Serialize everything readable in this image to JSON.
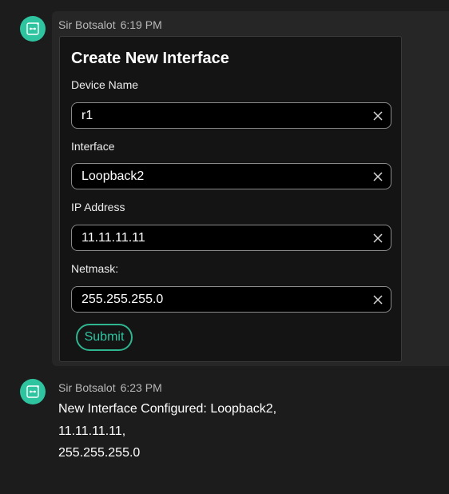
{
  "messages": [
    {
      "sender": "Sir Botsalot",
      "time": "6:19 PM",
      "form": {
        "title": "Create New Interface",
        "fields": [
          {
            "label": "Device Name",
            "value": "r1"
          },
          {
            "label": "Interface",
            "value": "Loopback2"
          },
          {
            "label": "IP Address",
            "value": "11.11.11.11"
          },
          {
            "label": "Netmask:",
            "value": "255.255.255.0"
          }
        ],
        "submit_label": "Submit"
      }
    },
    {
      "sender": "Sir Botsalot",
      "time": "6:23 PM",
      "lines": [
        "New Interface Configured: Loopback2,",
        "11.11.11.11,",
        "255.255.255.0"
      ]
    }
  ],
  "colors": {
    "background": "#1c1c1c",
    "message_highlight": "#262626",
    "card": "#141414",
    "accent": "#2ec4a0",
    "field_border": "#8a8a8a"
  },
  "icons": {
    "avatar": "bot-icon",
    "clear": "close-icon"
  }
}
